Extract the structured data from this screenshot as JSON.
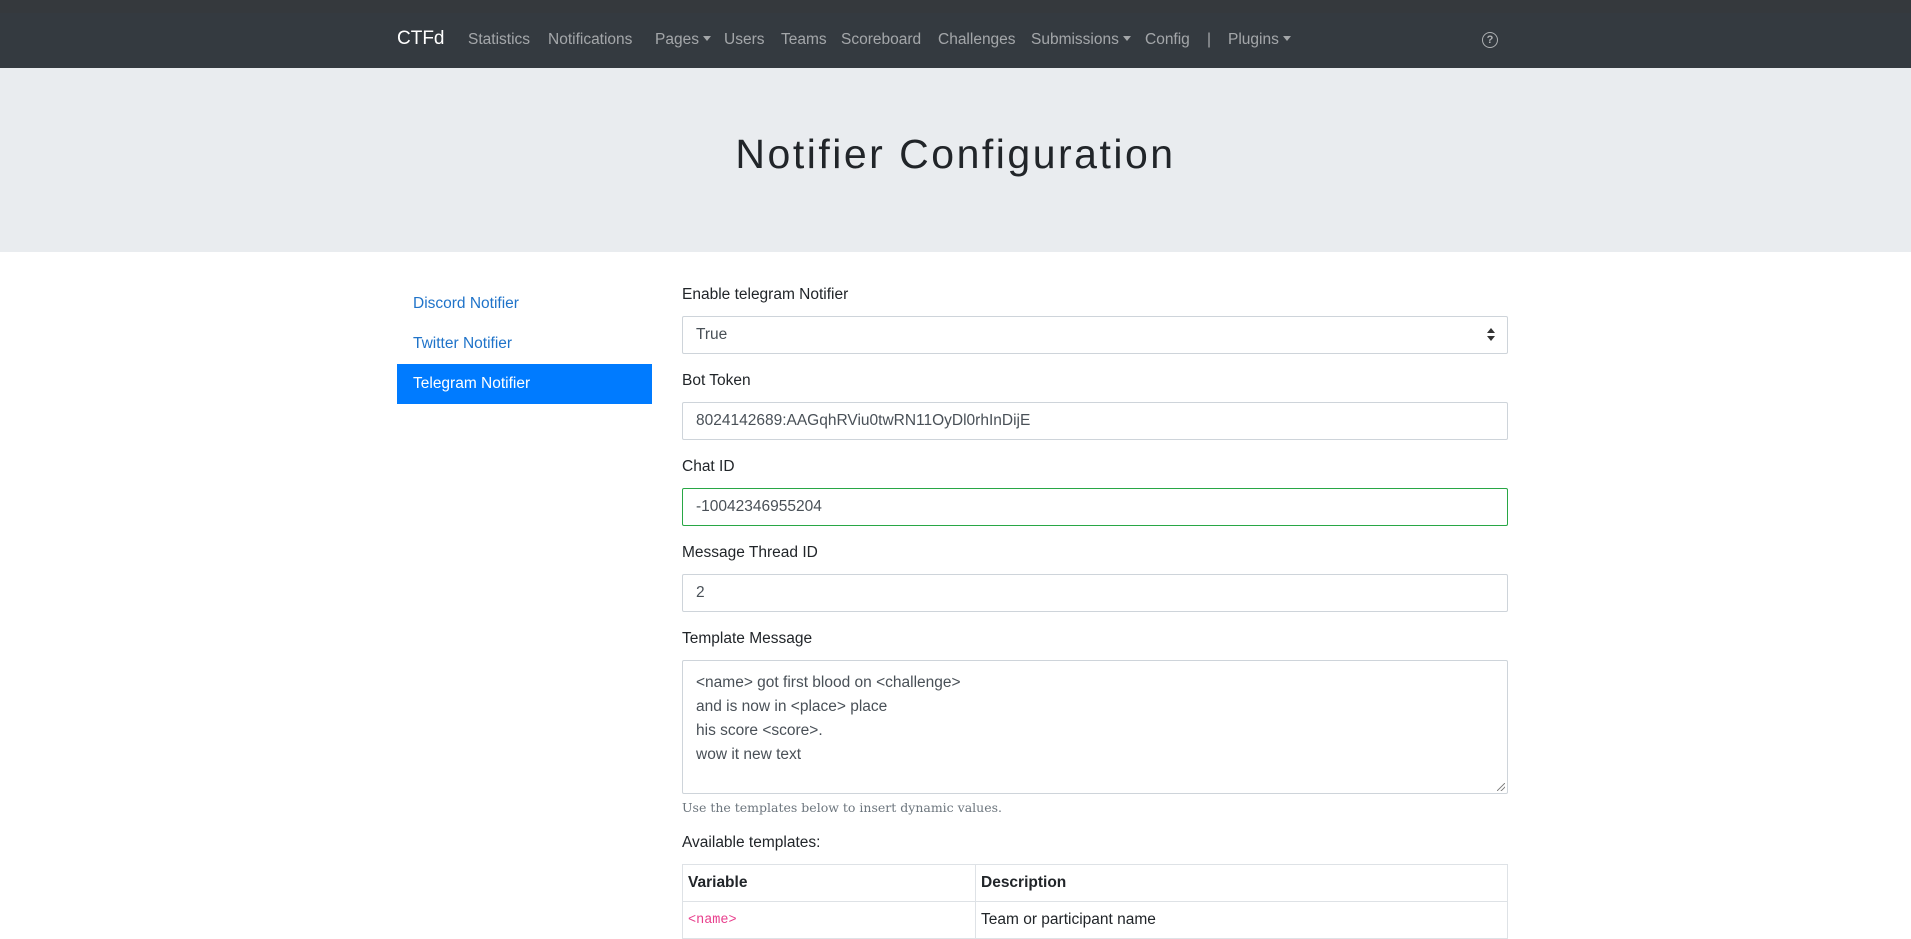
{
  "navbar": {
    "brand": "CTFd",
    "items": [
      {
        "label": "Statistics",
        "dropdown": false
      },
      {
        "label": "Notifications",
        "dropdown": false
      },
      {
        "label": "Pages",
        "dropdown": true
      },
      {
        "label": "Users",
        "dropdown": false
      },
      {
        "label": "Teams",
        "dropdown": false
      },
      {
        "label": "Scoreboard",
        "dropdown": false
      },
      {
        "label": "Challenges",
        "dropdown": false
      },
      {
        "label": "Submissions",
        "dropdown": true
      },
      {
        "label": "Config",
        "dropdown": false
      },
      {
        "label": "|",
        "dropdown": false
      },
      {
        "label": "Plugins",
        "dropdown": true
      }
    ],
    "help_icon": "question-circle-icon"
  },
  "page": {
    "title": "Notifier Configuration"
  },
  "sidebar": {
    "items": [
      {
        "label": "Discord Notifier",
        "active": false
      },
      {
        "label": "Twitter Notifier",
        "active": false
      },
      {
        "label": "Telegram Notifier",
        "active": true
      }
    ]
  },
  "form": {
    "enable_label": "Enable telegram Notifier",
    "enable_value": "True",
    "bot_token_label": "Bot Token",
    "bot_token_value": "8024142689:AAGqhRViu0twRN11OyDl0rhInDijE",
    "chat_id_label": "Chat ID",
    "chat_id_value": "-10042346955204",
    "thread_label": "Message Thread ID",
    "thread_value": "2",
    "template_label": "Template Message",
    "template_lines": [
      "<name> got first blood on <challenge>",
      "and is now in <place> place",
      "his score <score>.",
      "wow it new text"
    ],
    "help_text": "Use the templates below to insert dynamic values.",
    "available_label": "Available templates:"
  },
  "templates_table": {
    "headers": [
      "Variable",
      "Description"
    ],
    "rows": [
      {
        "variable": "<name>",
        "description": "Team or participant name"
      }
    ]
  },
  "colors": {
    "navbar_bg": "#343a40",
    "jumbotron_bg": "#e9ecef",
    "active_bg": "#007bff",
    "link": "#1f73c9",
    "valid_border": "#28a745",
    "code": "#e83e8c"
  }
}
